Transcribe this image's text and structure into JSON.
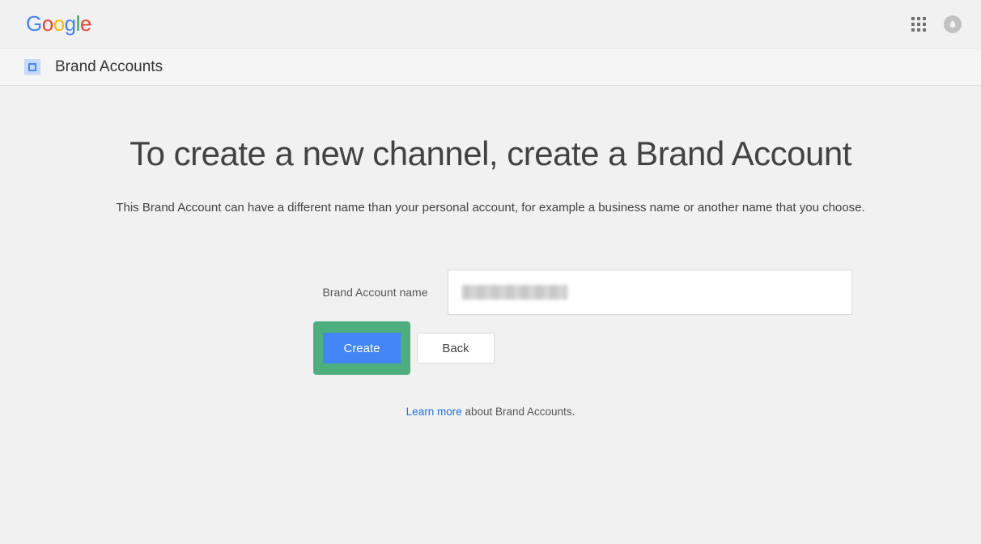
{
  "header": {
    "logo_text": "Google"
  },
  "subheader": {
    "title": "Brand Accounts"
  },
  "main": {
    "title": "To create a new channel, create a Brand Account",
    "subtitle": "This Brand Account can have a different name than your personal account, for example a business name or another name that you choose.",
    "form_label": "Brand Account name",
    "input_value": "",
    "create_label": "Create",
    "back_label": "Back",
    "learn_more_link": "Learn more",
    "learn_more_suffix": " about Brand Accounts."
  }
}
